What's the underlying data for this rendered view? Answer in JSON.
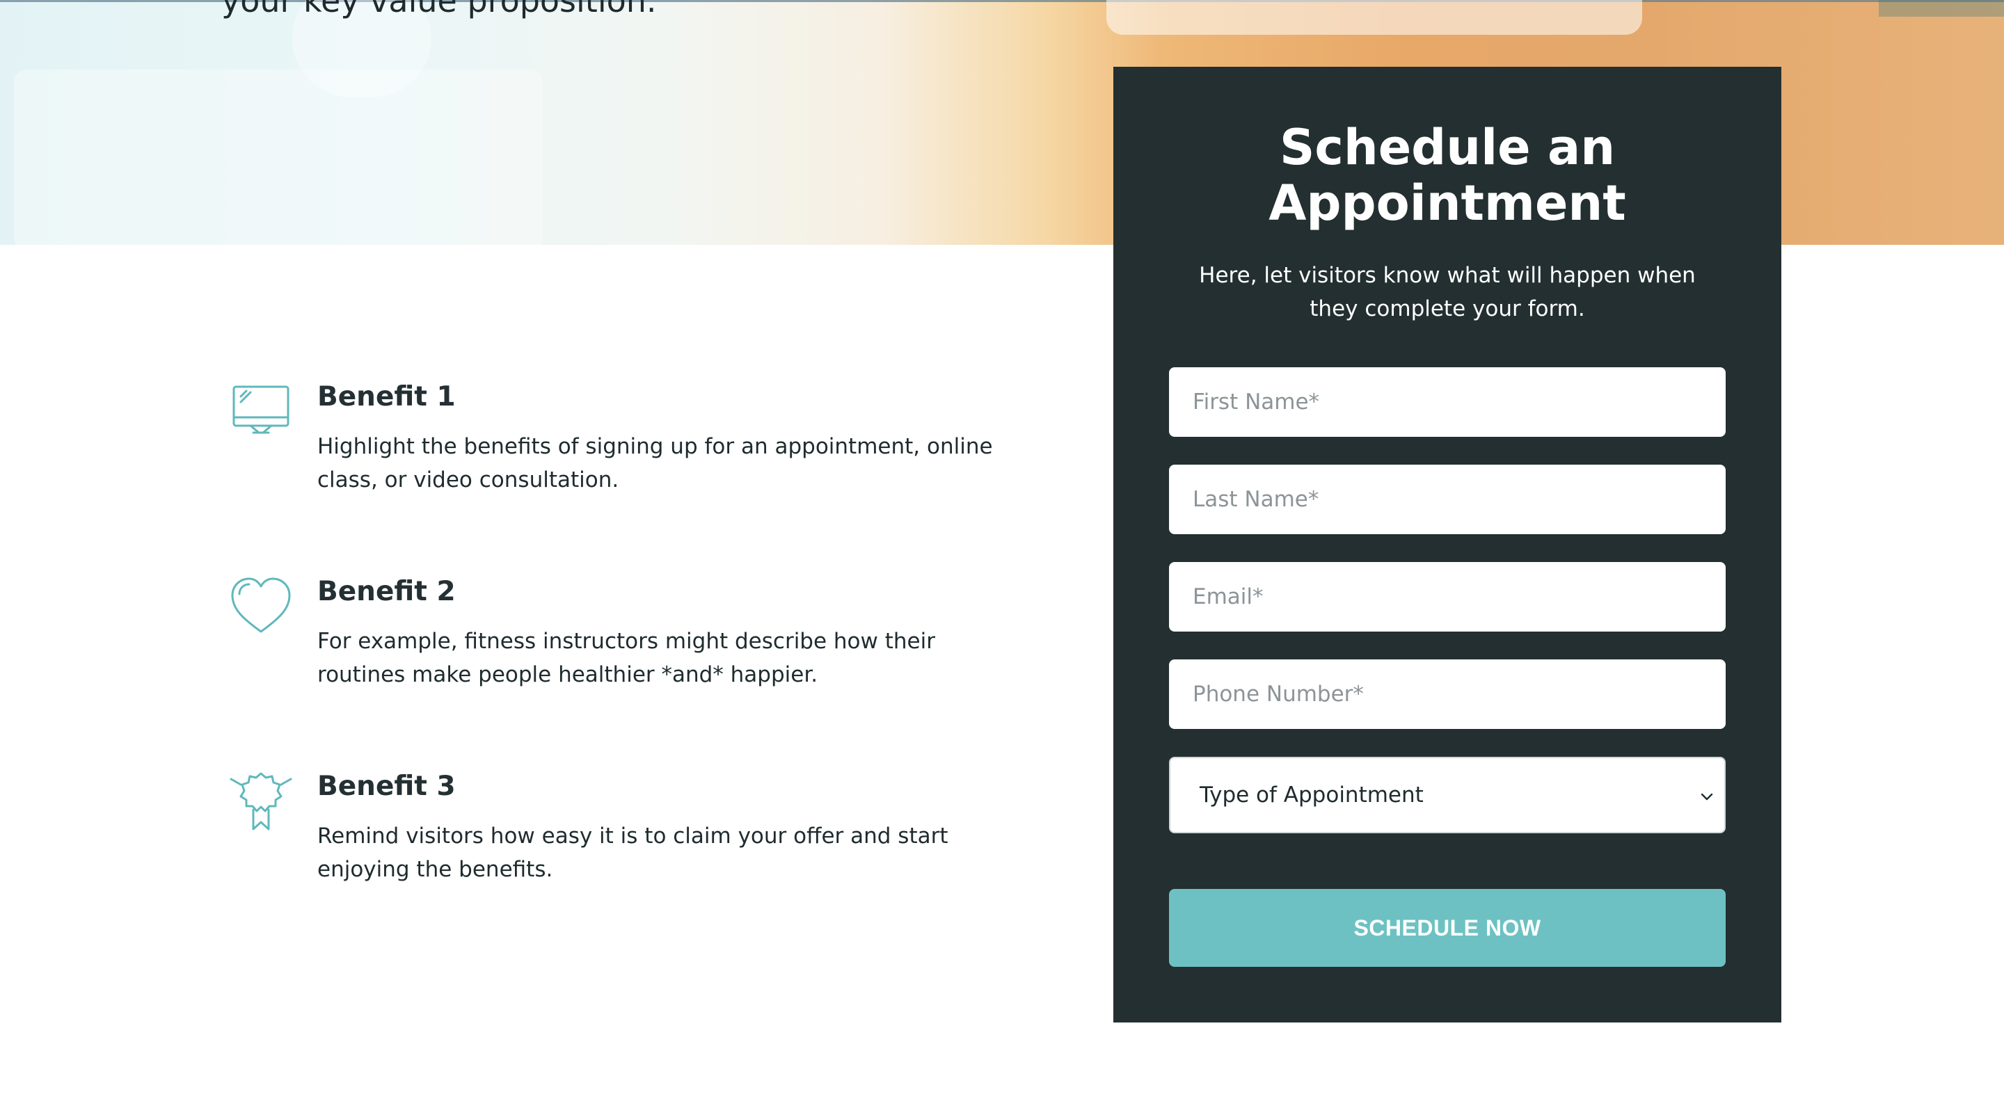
{
  "hero": {
    "tagline": "your key value proposition."
  },
  "benefits": [
    {
      "icon": "monitor-icon",
      "title": "Benefit 1",
      "text": "Highlight the benefits of signing up for an appointment, online class, or video consultation."
    },
    {
      "icon": "heart-icon",
      "title": "Benefit 2",
      "text": "For example, fitness instructors might describe how their routines make people healthier *and* happier."
    },
    {
      "icon": "award-ribbon-icon",
      "title": "Benefit 3",
      "text": "Remind visitors how easy it is to claim your offer and start enjoying the benefits."
    }
  ],
  "form": {
    "title": "Schedule an Appointment",
    "subtitle": "Here, let visitors know what will happen when they complete your form.",
    "fields": {
      "first_name_placeholder": "First Name*",
      "last_name_placeholder": "Last Name*",
      "email_placeholder": "Email*",
      "phone_placeholder": "Phone Number*"
    },
    "appointment_type": {
      "selected": "Type of Appointment",
      "icon": "chevron-down-icon"
    },
    "submit_label": "SCHEDULE NOW"
  },
  "colors": {
    "accent": "#6dc1c3",
    "card_background": "#232f30",
    "text_dark": "#1f2b2e"
  }
}
